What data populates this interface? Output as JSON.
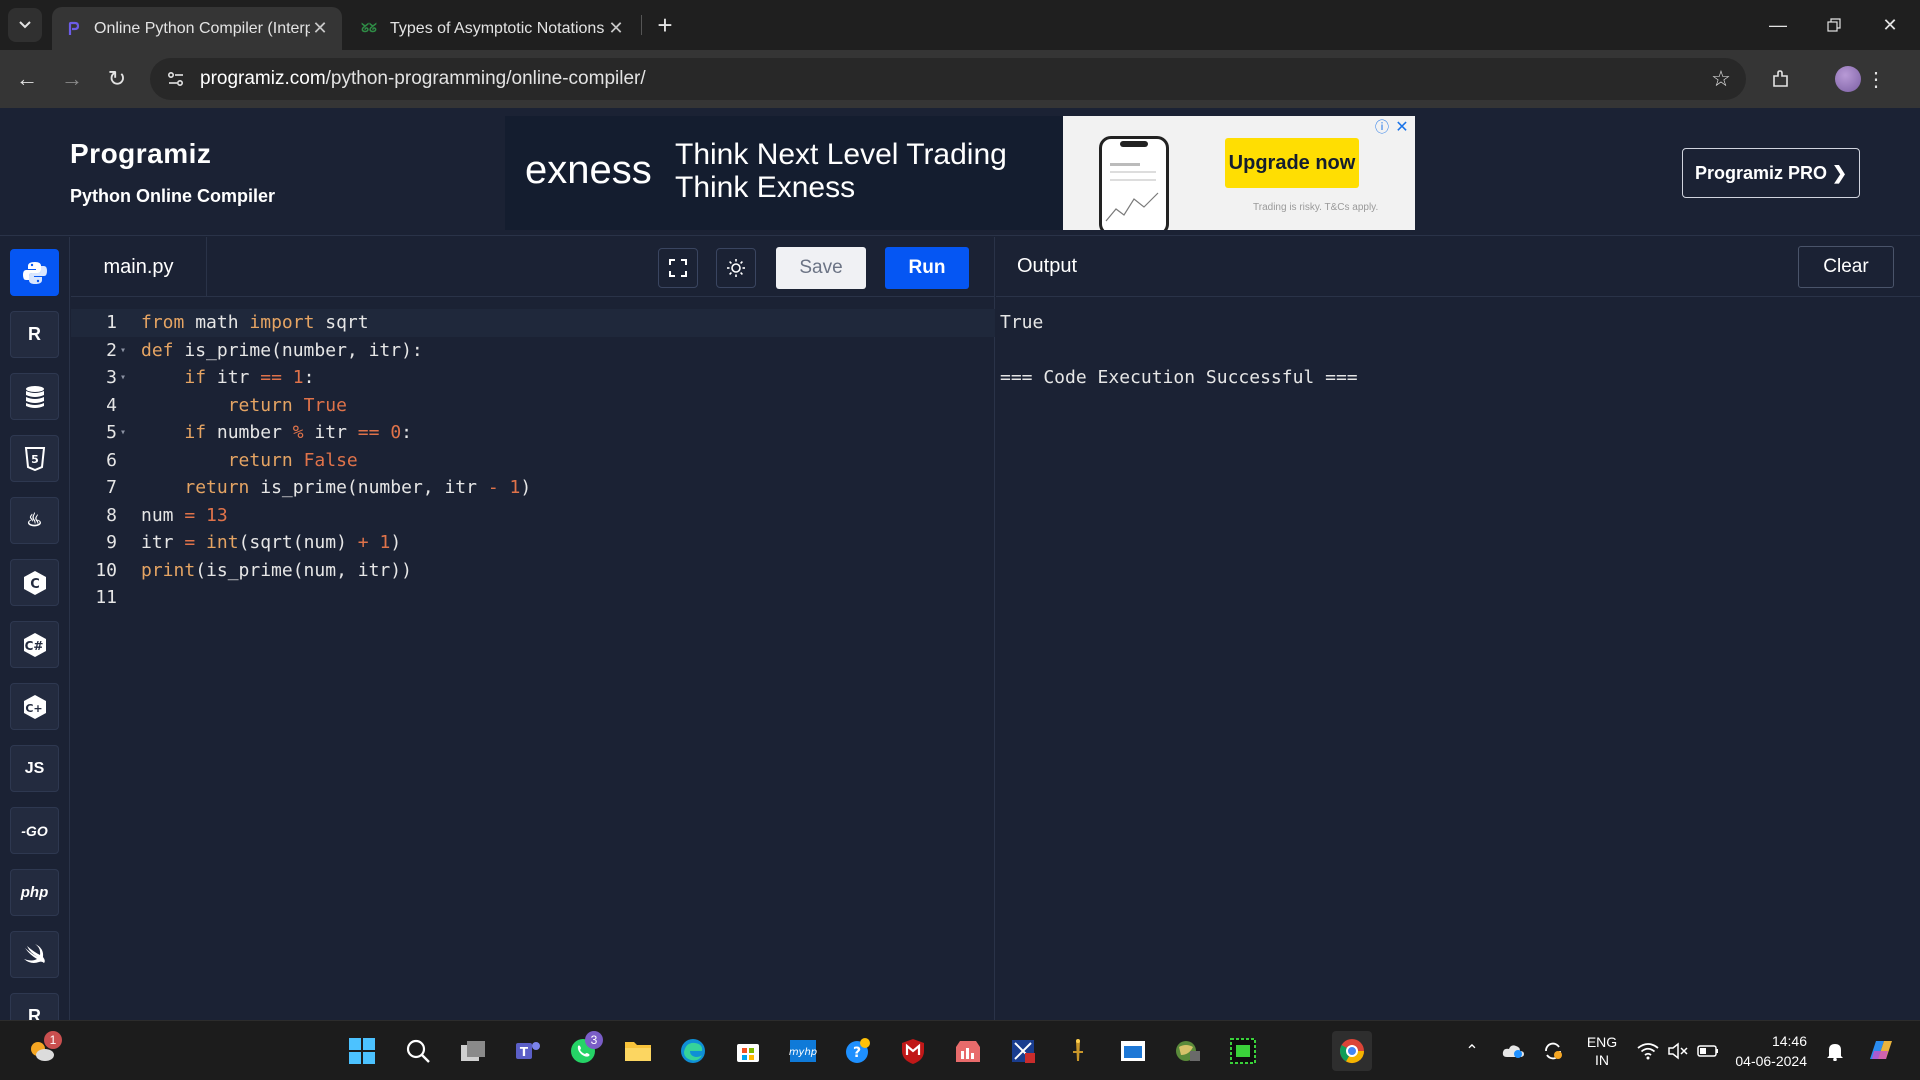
{
  "browser": {
    "tabs": [
      {
        "title": "Online Python Compiler (Interp",
        "active": true
      },
      {
        "title": "Types of Asymptotic Notations",
        "active": false
      }
    ],
    "url_domain": "programiz.com",
    "url_path": "/python-programming/online-compiler/"
  },
  "header": {
    "logo": "Programiz",
    "subtitle": "Python Online Compiler",
    "pro_button": "Programiz PRO ❯"
  },
  "ad": {
    "brand": "exness",
    "headline_line1": "Think Next Level Trading",
    "headline_line2": "Think Exness",
    "cta": "Upgrade now",
    "disclaimer": "Trading is risky. T&Cs apply."
  },
  "sidebar": {
    "languages": [
      {
        "name": "python",
        "label": "",
        "active": true
      },
      {
        "name": "r",
        "label": "R"
      },
      {
        "name": "sql",
        "label": ""
      },
      {
        "name": "html",
        "label": "5"
      },
      {
        "name": "java",
        "label": "♨"
      },
      {
        "name": "c",
        "label": "C"
      },
      {
        "name": "csharp",
        "label": "C#"
      },
      {
        "name": "cpp",
        "label": "C+"
      },
      {
        "name": "js",
        "label": "JS"
      },
      {
        "name": "go",
        "label": "-GO"
      },
      {
        "name": "php",
        "label": "php"
      },
      {
        "name": "swift",
        "label": ""
      },
      {
        "name": "rust",
        "label": "R"
      }
    ]
  },
  "editor": {
    "filename": "main.py",
    "save_label": "Save",
    "run_label": "Run",
    "line_numbers": [
      "1",
      "2",
      "3",
      "4",
      "5",
      "6",
      "7",
      "8",
      "9",
      "10",
      "11"
    ],
    "lines": [
      "from math import sqrt",
      "def is_prime(number, itr):",
      "    if itr == 1:",
      "        return True",
      "    if number % itr == 0:",
      "        return False",
      "    return is_prime(number, itr - 1)",
      "num = 13",
      "itr = int(sqrt(num) + 1)",
      "print(is_prime(num, itr))",
      ""
    ]
  },
  "output": {
    "title": "Output",
    "clear_label": "Clear",
    "line1": "True",
    "line2": "=== Code Execution Successful ==="
  },
  "taskbar": {
    "whatsapp_badge": "3",
    "weather_badge": "1",
    "lang_line1": "ENG",
    "lang_line2": "IN",
    "time": "14:46",
    "date": "04-06-2024"
  },
  "colors": {
    "page_bg": "#1b2234",
    "accent_blue": "#0556f3",
    "keyword": "#e5a463",
    "literal": "#e0734a",
    "ad_yellow": "#ffde02"
  }
}
